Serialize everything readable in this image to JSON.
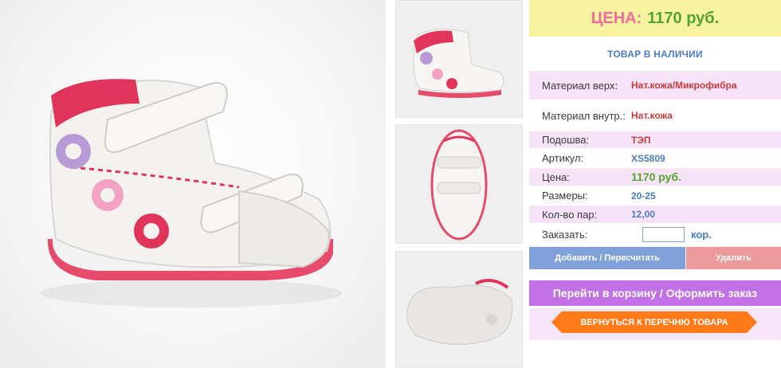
{
  "price": {
    "label": "ЦЕНА:",
    "value": "1170 руб."
  },
  "stock_status": "ТОВАР В НАЛИЧИИ",
  "specs": [
    {
      "label": "Материал верх:",
      "value": "Нат.кожа/Микрофибра"
    },
    {
      "label": "Материал внутр.:",
      "value": "Нат.кожа"
    },
    {
      "label": "Подошва:",
      "value": "ТЭП"
    },
    {
      "label": "Артикул:",
      "value": "XS5809"
    },
    {
      "label": "Цена:",
      "value": "1170 руб."
    },
    {
      "label": "Размеры:",
      "value": "20-25"
    },
    {
      "label": "Кол-во пар:",
      "value": "12,00"
    }
  ],
  "order": {
    "label": "Заказать:",
    "input_value": "",
    "unit": "кор."
  },
  "buttons": {
    "add": "Добавить / Пересчитать",
    "delete": "Удалить",
    "cart": "Перейти в корзину / Оформить заказ",
    "back": "ВЕРНУТЬСЯ К ПЕРЕЧНЮ ТОВАРА"
  },
  "colors": {
    "price_box": "#f8f19e",
    "price_label": "#ef6aa1",
    "price_value": "#52a52e",
    "stock_text": "#4b7dc4",
    "row_highlight": "#f7e3f8",
    "add_button": "#7fa0d8",
    "delete_button": "#ee9999",
    "cart_button": "#c170e6",
    "back_button": "#ff7a17"
  }
}
